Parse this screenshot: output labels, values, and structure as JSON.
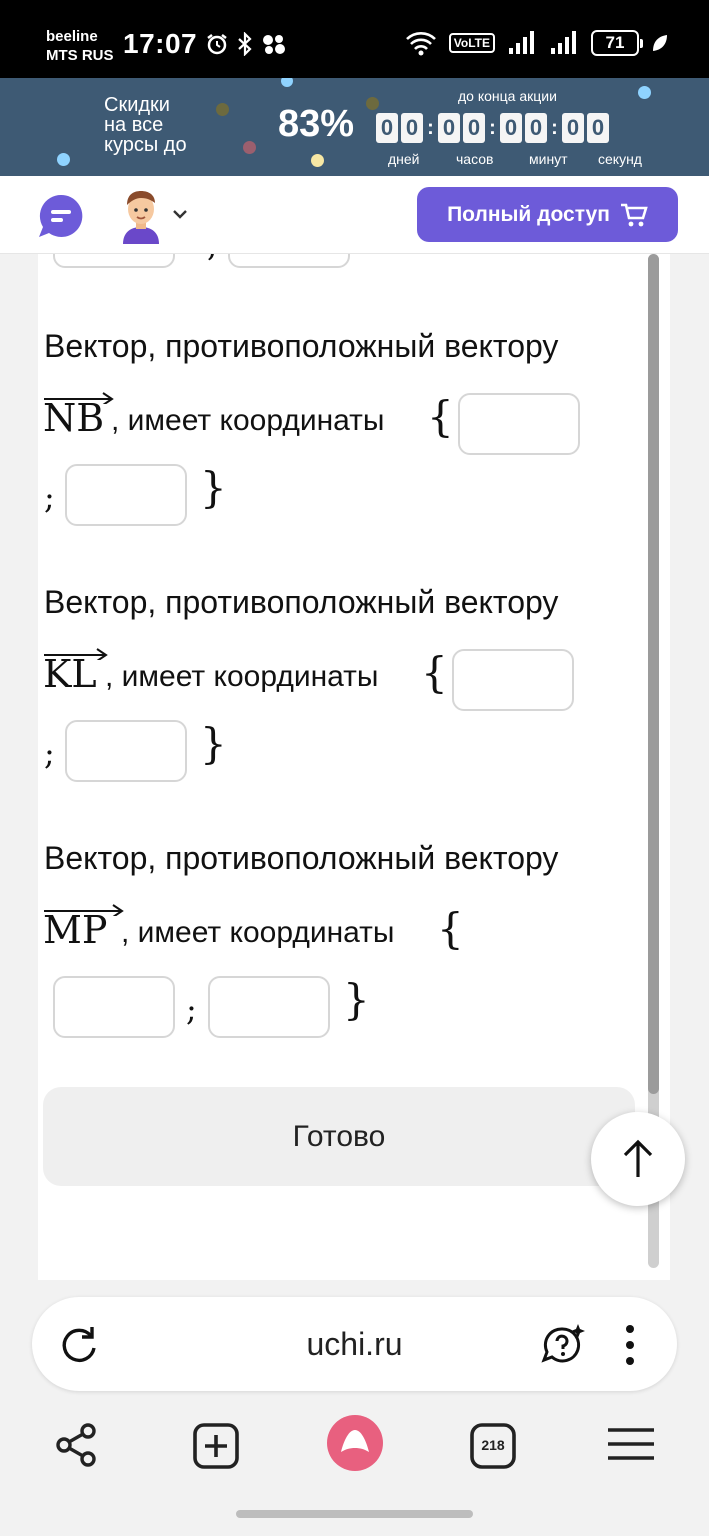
{
  "status_bar": {
    "carrier_line1": "beeline",
    "carrier_line2": "MTS RUS",
    "time": "17:07",
    "network": "VoLTE",
    "battery": "71"
  },
  "promo": {
    "text_line1": "Скидки",
    "text_line2": "на все",
    "text_line3": "курсы до",
    "percent": "83%",
    "countdown_caption": "до конца акции",
    "digits": [
      "0",
      "0",
      "0",
      "0",
      "0",
      "0",
      "0",
      "0"
    ],
    "units": [
      "дней",
      "часов",
      "минут",
      "секунд"
    ],
    "bg_color": "#3e5a74"
  },
  "header": {
    "full_access_label": "Полный доступ",
    "accent_color": "#6d5bd9"
  },
  "questions": [
    {
      "text": "Вектор, противоположный вектору",
      "vector": "NB",
      "rest": ", имеет координаты",
      "semicolon": ";"
    },
    {
      "text": "Вектор, противоположный вектору",
      "vector": "KL",
      "rest": ", имеет координаты",
      "semicolon": ";"
    },
    {
      "text": "Вектор, противоположный вектору",
      "vector": "MP",
      "rest": ", имеет координаты",
      "semicolon": ";"
    }
  ],
  "braces": {
    "open": "{",
    "close": "}"
  },
  "done_label": "Готово",
  "browser": {
    "url": "uchi.ru",
    "tabs_count": "218"
  }
}
